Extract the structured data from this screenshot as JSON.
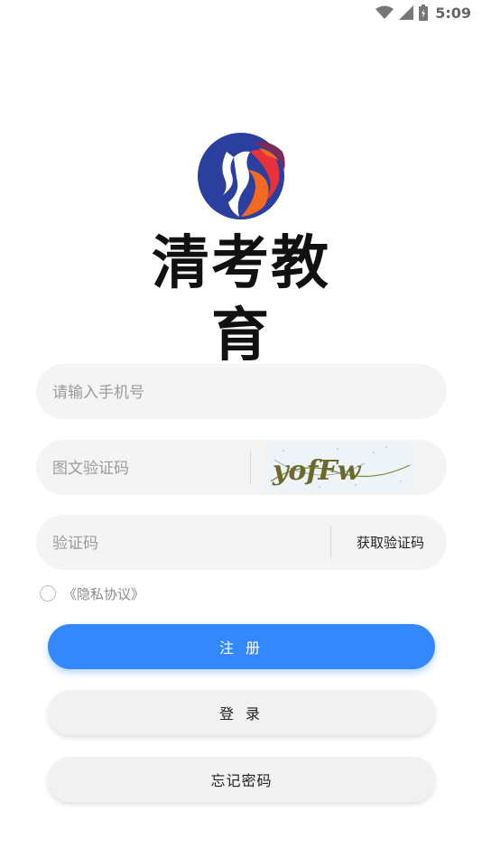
{
  "status_bar": {
    "time": "5:09",
    "icons": [
      "wifi-icon",
      "signal-icon",
      "battery-icon"
    ]
  },
  "brand": {
    "name": "清考教育",
    "colors": {
      "blue": "#2a3f9e",
      "orange": "#f26a21",
      "red": "#e8313a",
      "purple": "#7b2a5a"
    }
  },
  "form": {
    "phone_placeholder": "请输入手机号",
    "captcha_placeholder": "图文验证码",
    "captcha_image_text": "yofFw",
    "code_placeholder": "验证码",
    "get_code_label": "获取验证码"
  },
  "privacy": {
    "label": "《隐私协议》",
    "checked": false
  },
  "buttons": {
    "register": "注 册",
    "login": "登 录",
    "forgot_password": "忘记密码"
  },
  "theme": {
    "primary": "#3388ff",
    "field_bg": "#f4f4f4"
  }
}
